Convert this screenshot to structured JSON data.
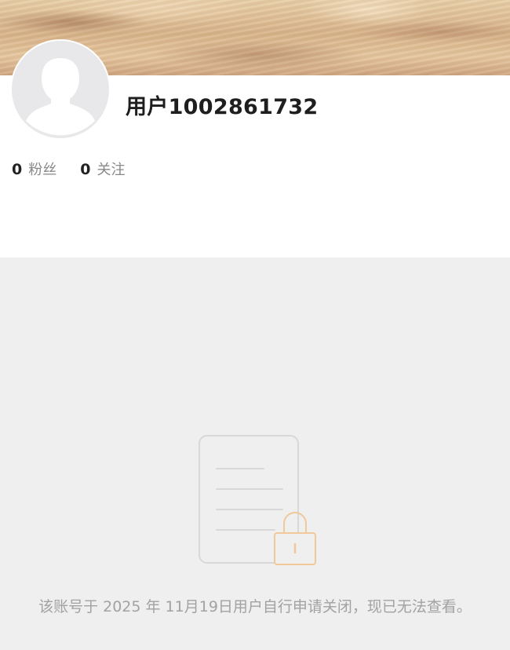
{
  "profile": {
    "username": "用户1002861732",
    "stats": [
      {
        "count": "0",
        "label": "粉丝"
      },
      {
        "count": "0",
        "label": "关注"
      }
    ]
  },
  "closed_notice": {
    "message": "该账号于 2025 年 11月19日用户自行申请关闭，现已无法查看。"
  },
  "icons": {
    "avatar": "default-avatar-silhouette-icon",
    "locked_document": "locked-document-icon"
  },
  "colors": {
    "lock_accent": "#f0c89a",
    "doc_outline": "#d8d8d8",
    "gray_background": "#efeff0"
  }
}
